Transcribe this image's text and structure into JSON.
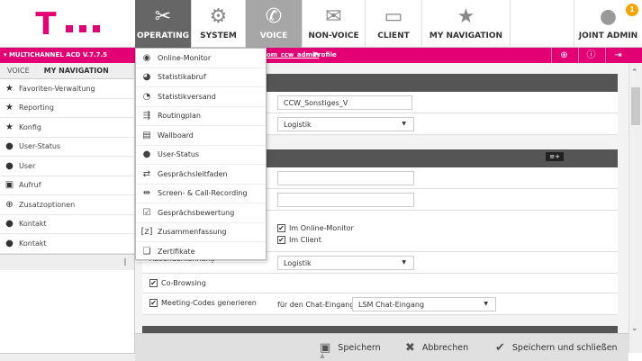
{
  "nav": {
    "operating": "OPERATING",
    "system": "SYSTEM",
    "voice": "VOICE",
    "nonvoice": "NON-VOICE",
    "client": "CLIENT",
    "mynav": "MY NAVIGATION",
    "joint": "JOINT ADMIN",
    "badge": "1"
  },
  "pinkbar": {
    "acd": "▾ MULTICHANNEL ACD  V.7.7.5",
    "user": "om_ccw_admin",
    "profile": "Profile"
  },
  "sidebar": {
    "tabs": [
      "VOICE",
      "MY NAVIGATION"
    ],
    "items": [
      {
        "label": "Favoriten-Verwaltung",
        "icon": "star-gear-icon"
      },
      {
        "label": "Reporting",
        "icon": "star-icon"
      },
      {
        "label": "Konfig",
        "icon": "star-icon"
      },
      {
        "label": "User-Status",
        "icon": "user-status-icon"
      },
      {
        "label": "User",
        "icon": "user-icon"
      },
      {
        "label": "Aufruf",
        "icon": "call-icon"
      },
      {
        "label": "Zusatzoptionen",
        "icon": "plus-icon"
      },
      {
        "label": "Kontakt",
        "icon": "user-icon"
      },
      {
        "label": "Kontakt",
        "icon": "user-icon"
      }
    ]
  },
  "menu": {
    "items": [
      {
        "label": "Online-Monitor",
        "icon": "eye-icon"
      },
      {
        "label": "Statistikabruf",
        "icon": "pie-chart-icon"
      },
      {
        "label": "Statistikversand",
        "icon": "pie-send-icon"
      },
      {
        "label": "Routingplan",
        "icon": "routing-icon"
      },
      {
        "label": "Wallboard",
        "icon": "wallboard-icon"
      },
      {
        "label": "User-Status",
        "icon": "user-status-icon"
      },
      {
        "label": "Gesprächsleitfaden",
        "icon": "guide-icon"
      },
      {
        "label": "Screen- & Call-Recording",
        "icon": "recording-icon"
      },
      {
        "label": "Gesprächsbewertung",
        "icon": "rating-icon"
      },
      {
        "label": "Zusammenfassung",
        "icon": "summary-icon"
      },
      {
        "label": "Zertifikate",
        "icon": "certificate-icon"
      }
    ]
  },
  "form": {
    "name_value": "CCW_Sonstiges_V",
    "select1": "Logistik",
    "chk_online": "Im Online-Monitor",
    "chk_client": "Im Client",
    "absender_label": "Absenderkennung",
    "absender_value": "Logistik",
    "cobrowsing": "Co-Browsing",
    "meeting": "Meeting-Codes generieren",
    "chat_label": "für den Chat-Eingang",
    "chat_value": "LSM Chat-Eingang"
  },
  "buttons": {
    "save": "Speichern",
    "cancel": "Abbrechen",
    "save_close": "Speichern und schließen"
  }
}
